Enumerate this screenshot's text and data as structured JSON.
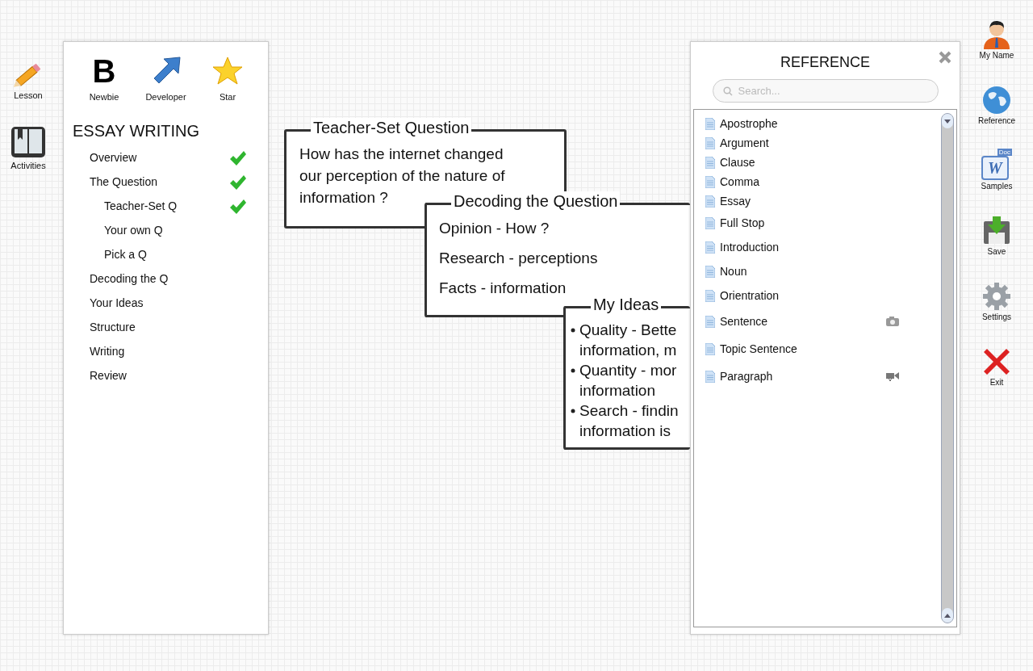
{
  "left_toolbar": [
    {
      "label": "Lesson",
      "kind": "pencil"
    },
    {
      "label": "Activities",
      "kind": "book"
    }
  ],
  "badges": [
    {
      "label": "Newbie",
      "kind": "letter",
      "glyph": "B"
    },
    {
      "label": "Developer",
      "kind": "arrow"
    },
    {
      "label": "Star",
      "kind": "star"
    }
  ],
  "course": {
    "title": "ESSAY WRITING",
    "steps": [
      {
        "label": "Overview",
        "checked": true
      },
      {
        "label": "The Question",
        "checked": true,
        "children": [
          {
            "label": "Teacher-Set Q",
            "checked": true
          },
          {
            "label": "Your own Q",
            "checked": false
          },
          {
            "label": "Pick a Q",
            "checked": false
          }
        ]
      },
      {
        "label": "Decoding the Q",
        "checked": false
      },
      {
        "label": "Your Ideas",
        "checked": false
      },
      {
        "label": "Structure",
        "checked": false
      },
      {
        "label": "Writing",
        "checked": false
      },
      {
        "label": "Review",
        "checked": false
      }
    ]
  },
  "mind_map": [
    {
      "kind": "paragraph",
      "title": "Teacher-Set Question",
      "lines": [
        "How has the internet changed",
        "our perception of the nature of",
        "information ?"
      ]
    },
    {
      "kind": "list",
      "title": "Decoding the Question",
      "items": [
        "Opinion - How ?",
        "Research - perceptions",
        "Facts - information"
      ]
    },
    {
      "kind": "bullets",
      "title": "My Ideas",
      "items": [
        {
          "lines": [
            "Quality - Bette",
            "information, m"
          ]
        },
        {
          "lines": [
            "Quantity - mor",
            "information"
          ]
        },
        {
          "lines": [
            "Search - findin",
            "information is"
          ]
        }
      ]
    }
  ],
  "reference": {
    "title": "REFERENCE",
    "search": {
      "placeholder": "Search..."
    },
    "items": [
      {
        "label": "Apostrophe",
        "kind": "plain"
      },
      {
        "label": "Argument",
        "kind": "plain"
      },
      {
        "label": "Clause",
        "kind": "plain"
      },
      {
        "label": "Comma",
        "kind": "plain"
      },
      {
        "label": "Essay",
        "kind": "plain"
      },
      {
        "label": "Full Stop",
        "kind": "plain"
      },
      {
        "label": "Introduction",
        "kind": "plain"
      },
      {
        "label": "Noun",
        "kind": "plain"
      },
      {
        "label": "Orientration",
        "kind": "plain"
      },
      {
        "label": "Sentence",
        "kind": "photo"
      },
      {
        "label": "Topic Sentence",
        "kind": "plain"
      },
      {
        "label": "Paragraph",
        "kind": "video"
      }
    ]
  },
  "right_toolbar": [
    {
      "label": "My Name",
      "kind": "person"
    },
    {
      "label": "Reference",
      "kind": "globe"
    },
    {
      "label": "Samples",
      "kind": "document",
      "tag": "Doc",
      "glyph": "W"
    },
    {
      "label": "Save",
      "kind": "save"
    },
    {
      "label": "Settings",
      "kind": "gear"
    },
    {
      "label": "Exit",
      "kind": "exit"
    }
  ]
}
